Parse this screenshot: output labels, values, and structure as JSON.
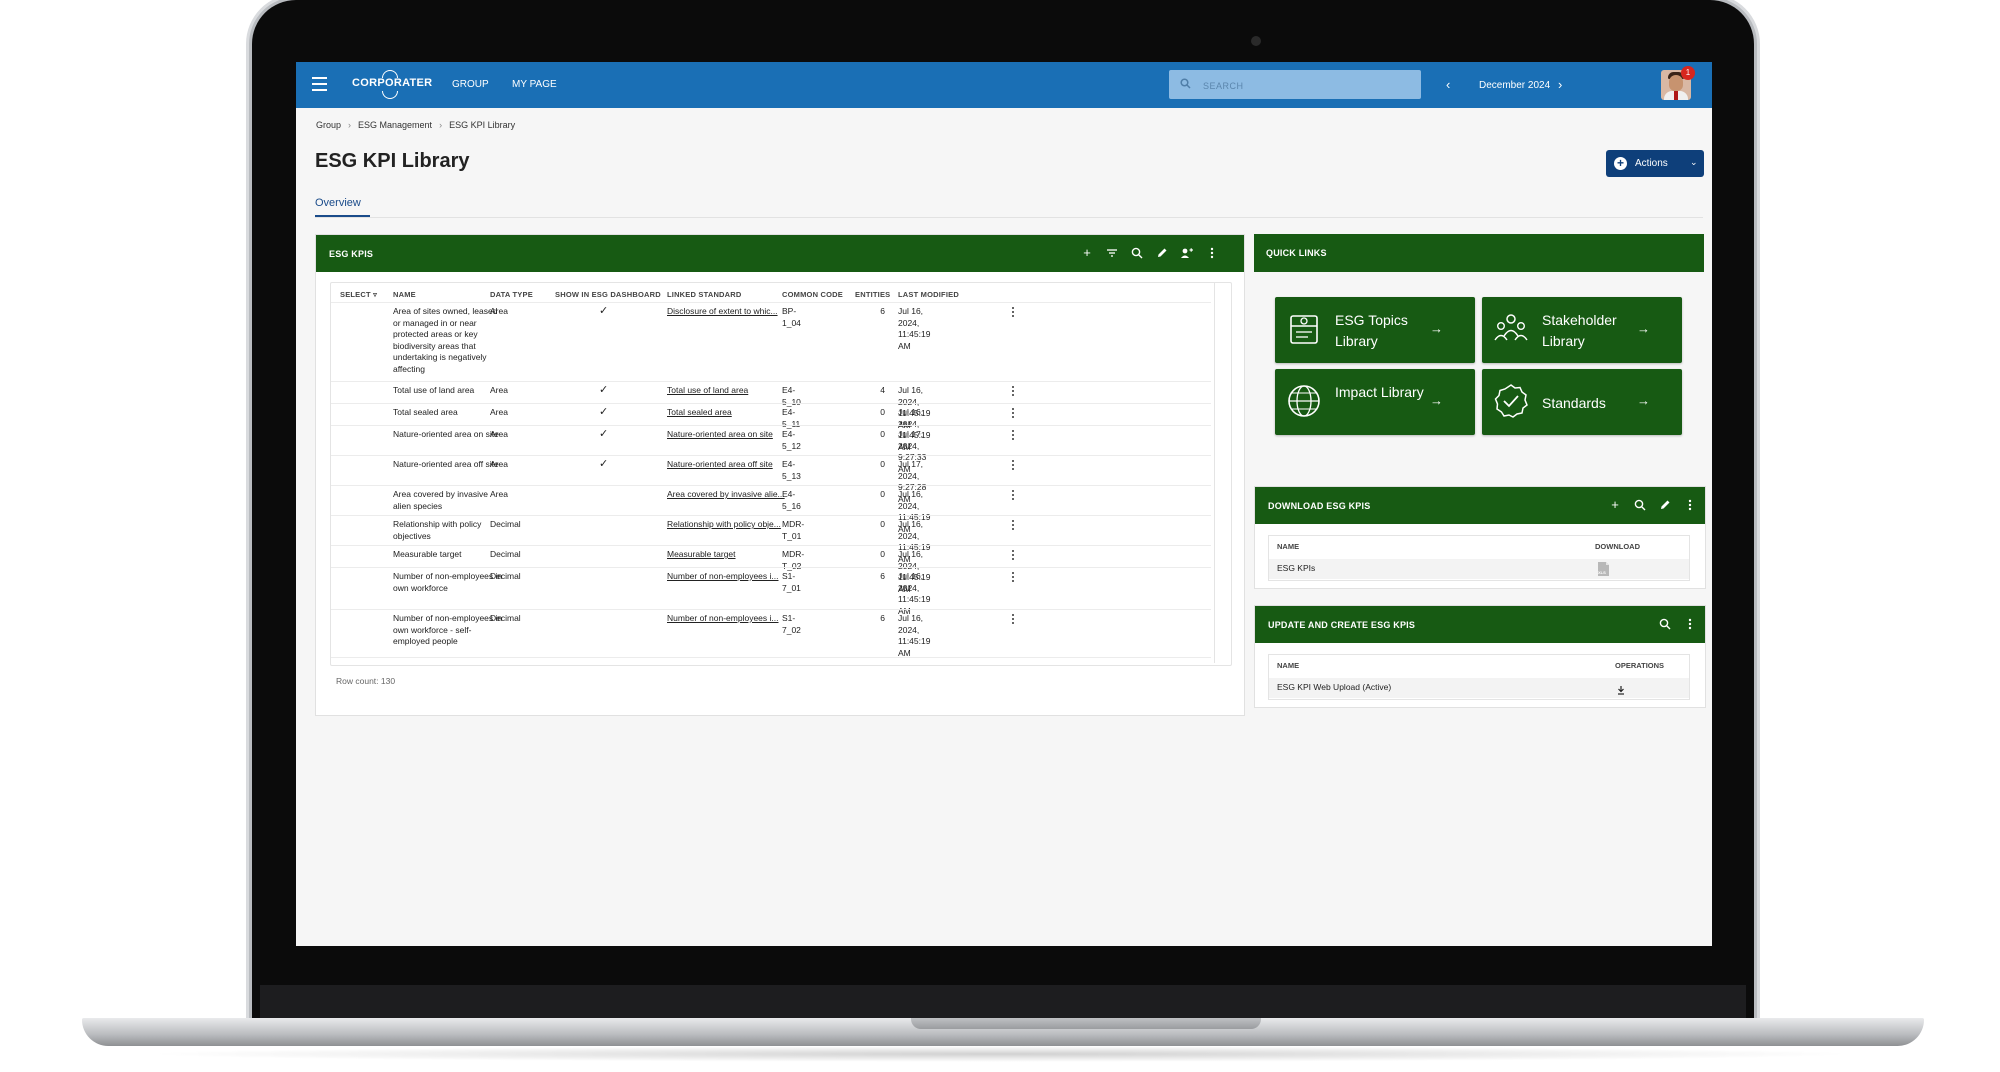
{
  "app": {
    "logo": "CORPORATER",
    "nav": [
      "GROUP",
      "MY PAGE"
    ],
    "search_placeholder": "SEARCH",
    "period": "December 2024",
    "notification_count": "1"
  },
  "breadcrumb": [
    "Group",
    "ESG Management",
    "ESG KPI Library"
  ],
  "page": {
    "title": "ESG KPI Library",
    "actions_label": "Actions",
    "tab": "Overview"
  },
  "kpis_panel": {
    "title": "ESG KPIS",
    "columns": [
      "SELECT",
      "NAME",
      "DATA TYPE",
      "SHOW IN ESG DASHBOARD",
      "LINKED STANDARD",
      "COMMON CODE",
      "ENTITIES",
      "LAST MODIFIED"
    ],
    "rows": [
      {
        "name": "Area of sites owned, leased or managed in or near protected areas or key biodiversity areas that undertaking is negatively affecting",
        "type": "Area",
        "dashboard": true,
        "standard": "Disclosure of extent to whic...",
        "code": "BP-1_04",
        "entities": "6",
        "modified": "Jul 16, 2024, 11:45:19 AM"
      },
      {
        "name": "Total use of land area",
        "type": "Area",
        "dashboard": true,
        "standard": "Total use of land area",
        "code": "E4-5_10",
        "entities": "4",
        "modified": "Jul 16, 2024, 11:45:19 AM"
      },
      {
        "name": "Total sealed area",
        "type": "Area",
        "dashboard": true,
        "standard": "Total sealed area",
        "code": "E4-5_11",
        "entities": "0",
        "modified": "Jul 16, 2024, 11:45:19 AM"
      },
      {
        "name": "Nature-oriented area on site",
        "type": "Area",
        "dashboard": true,
        "standard": "Nature-oriented area on site",
        "code": "E4-5_12",
        "entities": "0",
        "modified": "Jul 17, 2024, 9:27:33 AM"
      },
      {
        "name": "Nature-oriented area off site",
        "type": "Area",
        "dashboard": true,
        "standard": "Nature-oriented area off site",
        "code": "E4-5_13",
        "entities": "0",
        "modified": "Jul 17, 2024, 9:27:28 AM"
      },
      {
        "name": "Area covered by invasive alien species",
        "type": "Area",
        "dashboard": false,
        "standard": "Area covered by invasive alie...",
        "code": "E4-5_16",
        "entities": "0",
        "modified": "Jul 16, 2024, 11:45:19 AM"
      },
      {
        "name": "Relationship with policy objectives",
        "type": "Decimal",
        "dashboard": false,
        "standard": "Relationship with policy obje...",
        "code": "MDR-T_01",
        "entities": "0",
        "modified": "Jul 16, 2024, 11:45:19 AM"
      },
      {
        "name": "Measurable target",
        "type": "Decimal",
        "dashboard": false,
        "standard": "Measurable target",
        "code": "MDR-T_02",
        "entities": "0",
        "modified": "Jul 16, 2024, 11:45:19 AM"
      },
      {
        "name": "Number of non-employees in own workforce",
        "type": "Decimal",
        "dashboard": false,
        "standard": "Number of non-employees i...",
        "code": "S1-7_01",
        "entities": "6",
        "modified": "Jul 16, 2024, 11:45:19 AM"
      },
      {
        "name": "Number of non-employees in own workforce - self-employed people",
        "type": "Decimal",
        "dashboard": false,
        "standard": "Number of non-employees i...",
        "code": "S1-7_02",
        "entities": "6",
        "modified": "Jul 16, 2024, 11:45:19 AM"
      }
    ],
    "row_count": "Row count: 130"
  },
  "quick_links": {
    "title": "QUICK LINKS",
    "tiles": [
      {
        "label": "ESG Topics Library",
        "icon": "topics-library-icon"
      },
      {
        "label": "Stakeholder Library",
        "icon": "stakeholder-icon"
      },
      {
        "label": "Impact Library",
        "icon": "globe-icon"
      },
      {
        "label": "Standards",
        "icon": "badge-check-icon"
      }
    ]
  },
  "download_panel": {
    "title": "DOWNLOAD ESG KPIS",
    "col_name": "NAME",
    "col_download": "DOWNLOAD",
    "row_name": "ESG KPIs",
    "file_type": "XLS"
  },
  "update_panel": {
    "title": "UPDATE AND CREATE ESG KPIS",
    "col_name": "NAME",
    "col_ops": "OPERATIONS",
    "row_name": "ESG KPI Web Upload (Active)"
  },
  "colors": {
    "header_blue": "#1a6fb5",
    "panel_green": "#175a13",
    "actions_navy": "#0e3f7a"
  }
}
